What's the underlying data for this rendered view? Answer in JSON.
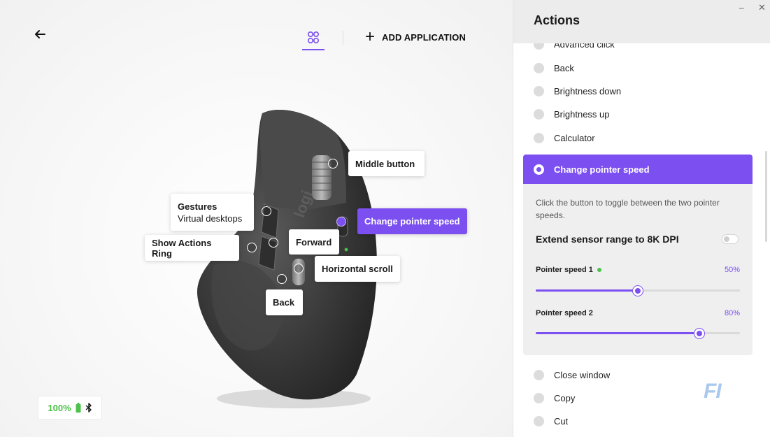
{
  "header": {
    "add_application": "ADD APPLICATION"
  },
  "callouts": {
    "middle_button": "Middle button",
    "change_pointer_speed": "Change pointer speed",
    "gestures_title": "Gestures",
    "gestures_sub": "Virtual desktops",
    "show_actions_ring": "Show Actions Ring",
    "forward": "Forward",
    "horizontal_scroll": "Horizontal scroll",
    "back": "Back"
  },
  "battery": {
    "percent": "100%",
    "level": 1.0
  },
  "mouse_logo": "logi",
  "panel": {
    "title": "Actions",
    "items_above": [
      "Advanced click",
      "Back",
      "Brightness down",
      "Brightness up",
      "Calculator"
    ],
    "selected": {
      "label": "Change pointer speed",
      "description": "Click the button to toggle between the two pointer speeds.",
      "extend_label": "Extend sensor range to 8K DPI",
      "extend_enabled": false,
      "speed1_label": "Pointer speed 1",
      "speed1_value": "50%",
      "speed2_label": "Pointer speed 2",
      "speed2_value": "80%"
    },
    "items_below": [
      "Close window",
      "Copy",
      "Cut"
    ]
  },
  "watermark": "FI",
  "colors": {
    "accent": "#7b4ff0",
    "battery": "#4cc24a"
  }
}
